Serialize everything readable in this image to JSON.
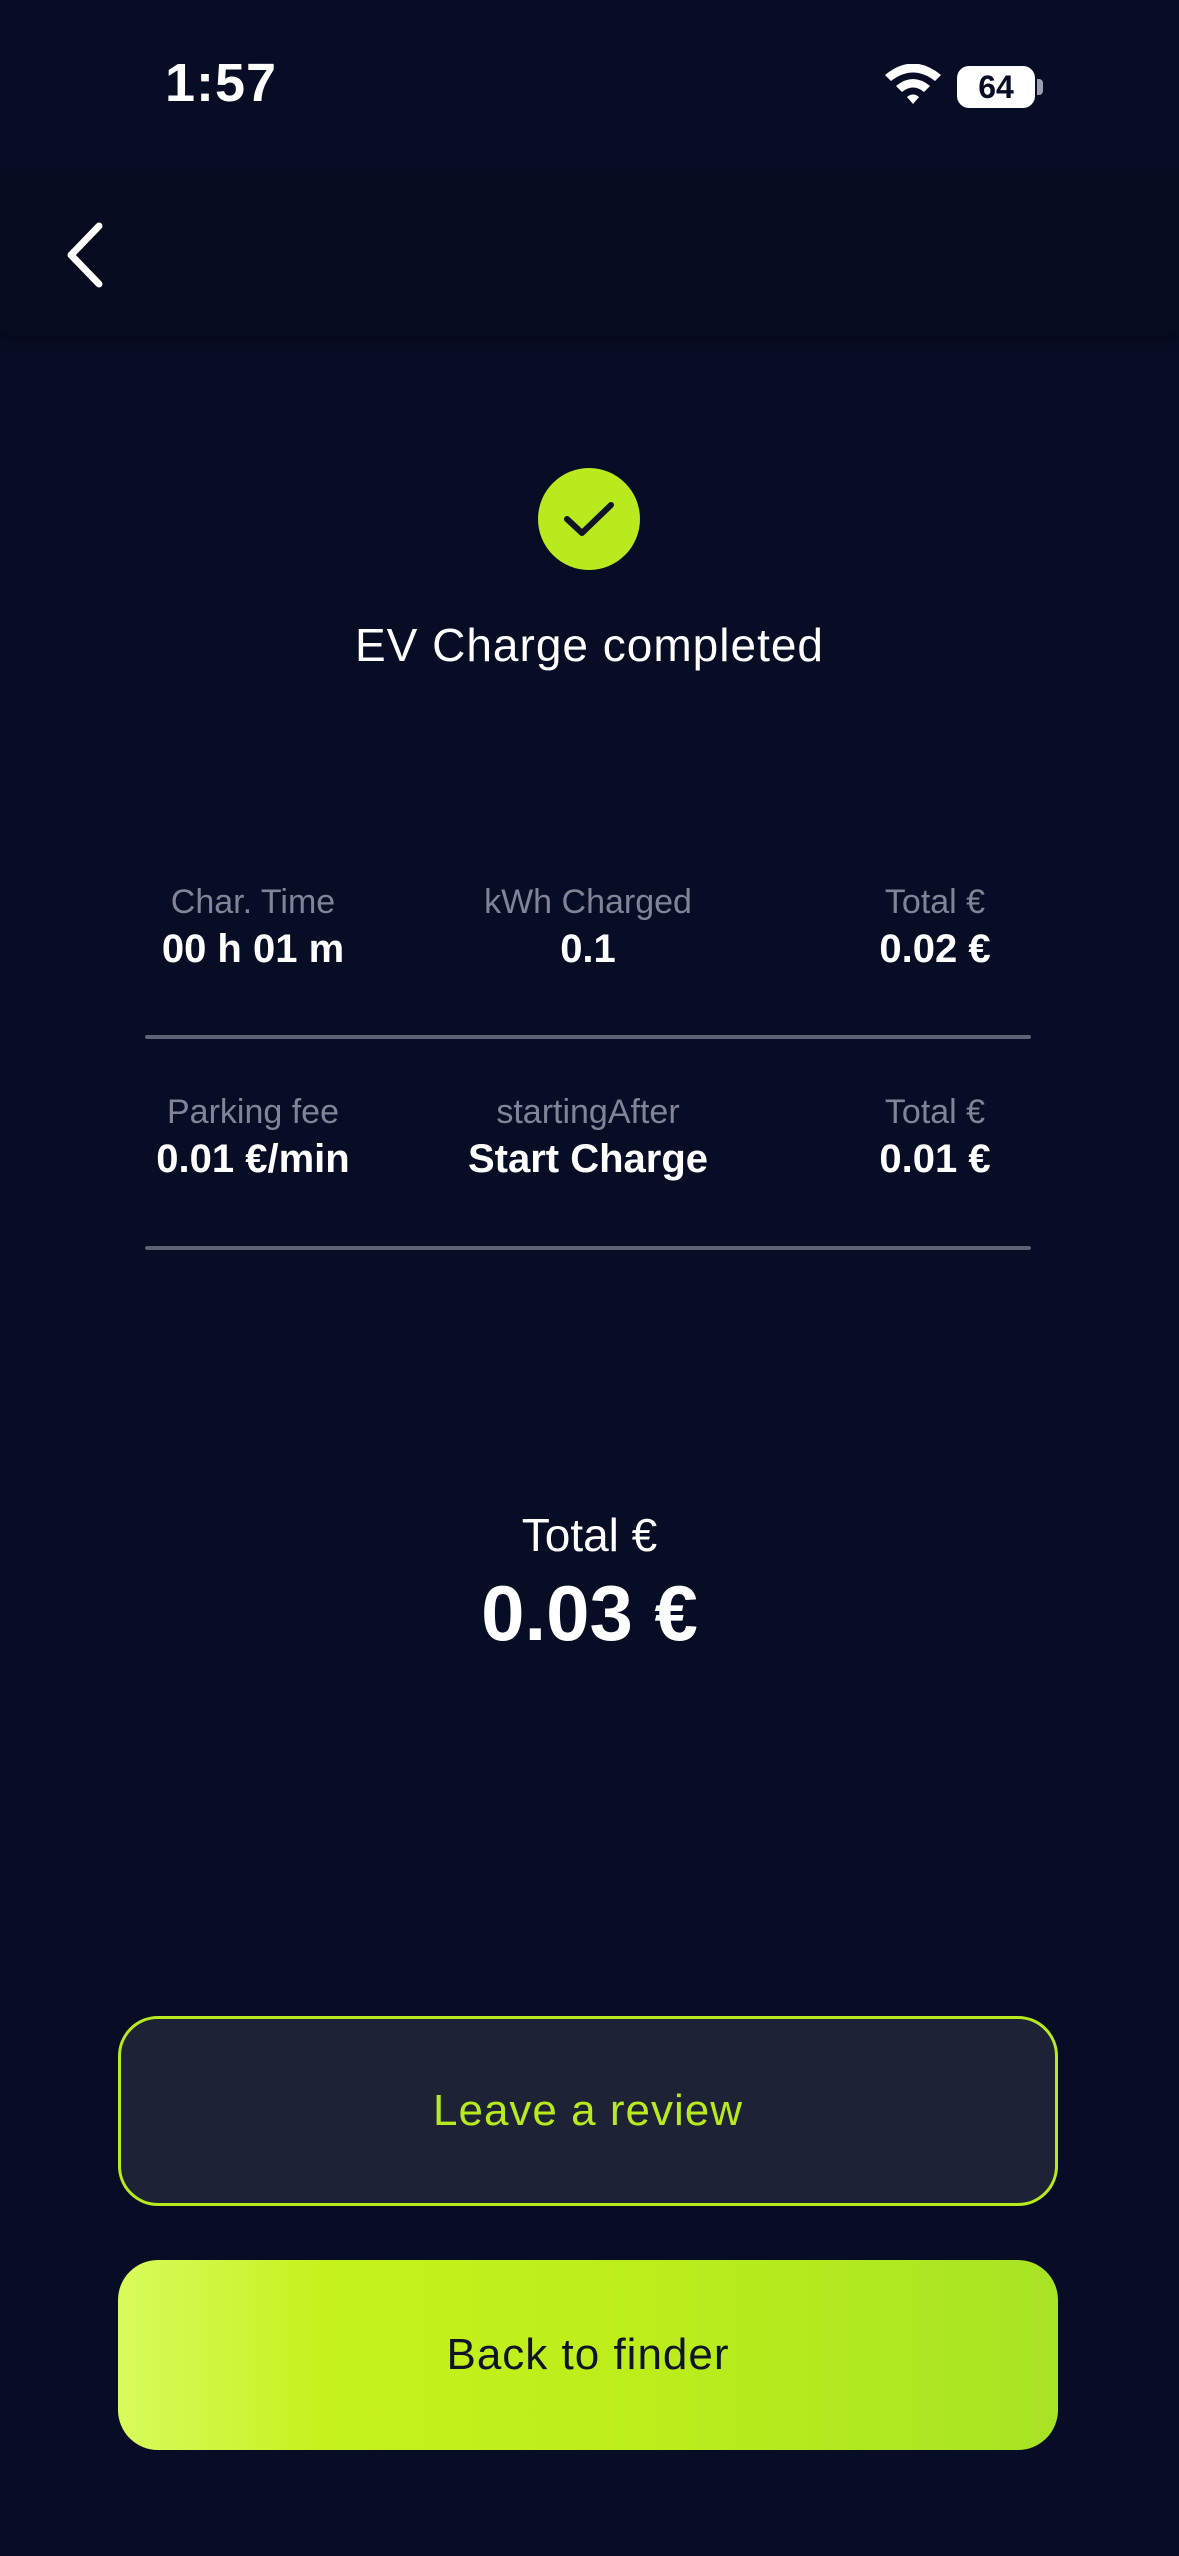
{
  "status_bar": {
    "time": "1:57",
    "battery_level": "64"
  },
  "header": {
    "back_icon": "chevron-left-icon"
  },
  "summary": {
    "status_icon": "checkmark-icon",
    "title": "EV Charge completed",
    "accent_color": "#b8ea1e"
  },
  "charge_stats": [
    {
      "label": "Char. Time",
      "value": "00 h 01 m"
    },
    {
      "label": "kWh Charged",
      "value": "0.1"
    },
    {
      "label": "Total €",
      "value": "0.02 €"
    }
  ],
  "parking_stats": [
    {
      "label": "Parking fee",
      "value": "0.01 €/min"
    },
    {
      "label": "startingAfter",
      "value": "Start Charge"
    },
    {
      "label": "Total €",
      "value": "0.01 €"
    }
  ],
  "total": {
    "label": "Total €",
    "value": "0.03 €"
  },
  "actions": {
    "review_label": "Leave a review",
    "finder_label": "Back to finder"
  }
}
